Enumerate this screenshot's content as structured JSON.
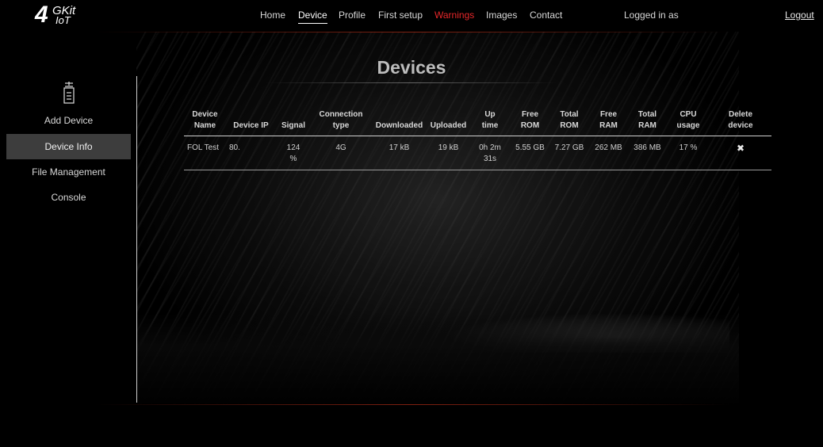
{
  "logo": {
    "main": "4",
    "top": "GKit",
    "bottom": "IoT"
  },
  "nav": {
    "items": [
      {
        "label": "Home"
      },
      {
        "label": "Device"
      },
      {
        "label": "Profile"
      },
      {
        "label": "First setup"
      },
      {
        "label": "Warnings"
      },
      {
        "label": "Images"
      },
      {
        "label": "Contact"
      }
    ],
    "active": "Device",
    "warning_color": "#e8272a"
  },
  "session": {
    "logged_in_label": "Logged in as",
    "logout_label": "Logout"
  },
  "page": {
    "title": "Devices"
  },
  "sidebar": {
    "icon": "device-icon",
    "items": [
      {
        "label": "Add Device"
      },
      {
        "label": "Device Info"
      },
      {
        "label": "File Management"
      },
      {
        "label": "Console"
      }
    ],
    "active": "Device Info"
  },
  "devices_table": {
    "headers": [
      [
        "Device",
        "Name"
      ],
      [
        "Device IP"
      ],
      [
        "Signal"
      ],
      [
        "Connection",
        "type"
      ],
      [
        "Downloaded"
      ],
      [
        "Uploaded"
      ],
      [
        "Up",
        "time"
      ],
      [
        "Free",
        "ROM"
      ],
      [
        "Total",
        "ROM"
      ],
      [
        "Free",
        "RAM"
      ],
      [
        "Total",
        "RAM"
      ],
      [
        "CPU",
        "usage"
      ],
      [
        "Delete",
        "device"
      ]
    ],
    "rows": [
      {
        "name": "FOL Test",
        "ip": "80.",
        "signal": [
          "124",
          "%"
        ],
        "connection": "4G",
        "downloaded": "17 kB",
        "uploaded": "19 kB",
        "uptime": [
          "0h 2m",
          "31s"
        ],
        "free_rom": "5.55 GB",
        "total_rom": "7.27 GB",
        "free_ram": "262 MB",
        "total_ram": "386 MB",
        "cpu": "17 %",
        "delete": "✖"
      }
    ]
  }
}
